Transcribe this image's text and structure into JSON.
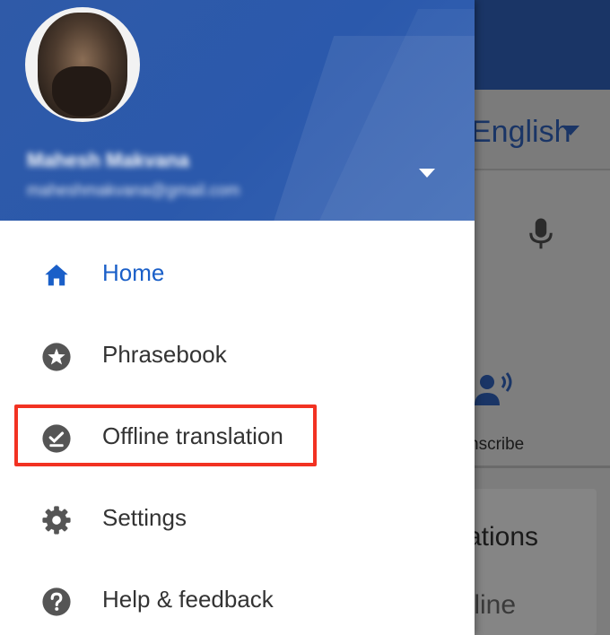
{
  "background_app": {
    "target_language": "English",
    "transcribe_label": "nscribe",
    "card_title": "ations",
    "card_subtitle": "fline"
  },
  "drawer": {
    "account": {
      "name": "Mahesh Makvana",
      "email": "maheshmakvana@gmail.com"
    },
    "menu": [
      {
        "label": "Home",
        "icon": "home-icon",
        "active": true
      },
      {
        "label": "Phrasebook",
        "icon": "star-icon",
        "active": false
      },
      {
        "label": "Offline translation",
        "icon": "offline-check-icon",
        "active": false,
        "highlighted": true
      },
      {
        "label": "Settings",
        "icon": "gear-icon",
        "active": false
      },
      {
        "label": "Help & feedback",
        "icon": "help-icon",
        "active": false
      }
    ]
  },
  "colors": {
    "header_blue": "#2f5aa8",
    "active_blue": "#1a5fc8",
    "highlight_red": "#f23222",
    "icon_grey": "#555555"
  }
}
